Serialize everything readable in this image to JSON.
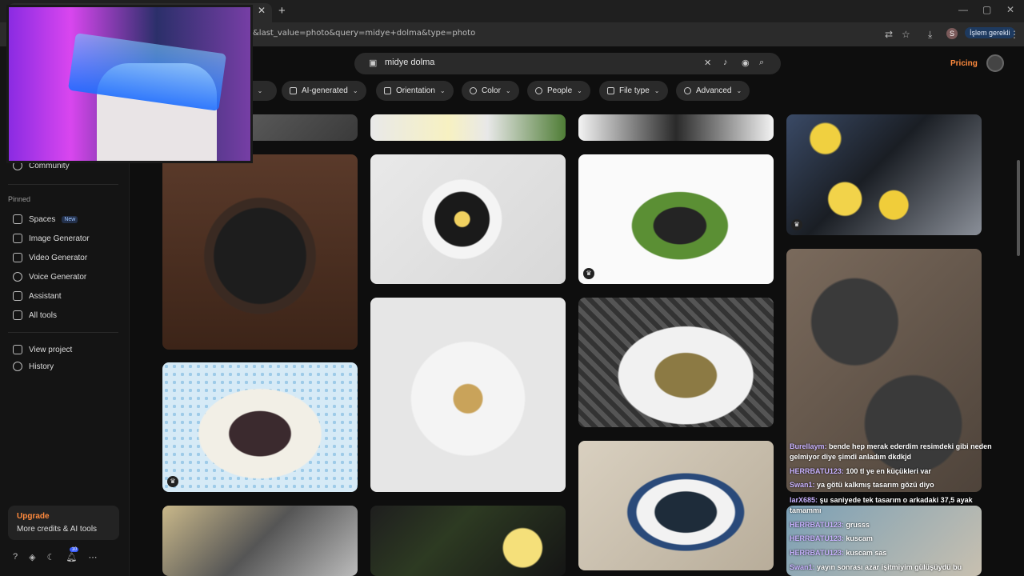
{
  "browser": {
    "url": "&last_value=photo&query=midye+dolma&type=photo",
    "new_tab": "+",
    "close_tab": "✕",
    "profile_letter": "S",
    "pending_label": "İşlem gerekli"
  },
  "sidebar": {
    "community": "Community",
    "pinned_heading": "Pinned",
    "items": [
      {
        "label": "Spaces",
        "badge": "New"
      },
      {
        "label": "Image Generator"
      },
      {
        "label": "Video Generator"
      },
      {
        "label": "Voice Generator"
      },
      {
        "label": "Assistant"
      },
      {
        "label": "All tools"
      }
    ],
    "view_project": "View project",
    "history": "History",
    "upgrade_title": "Upgrade",
    "upgrade_sub": "More credits & AI tools",
    "notif_count": "10"
  },
  "search": {
    "value": "midye dolma"
  },
  "header": {
    "pricing": "Pricing"
  },
  "filters": [
    {
      "label": "e"
    },
    {
      "label": "AI-generated"
    },
    {
      "label": "Orientation"
    },
    {
      "label": "Color"
    },
    {
      "label": "People"
    },
    {
      "label": "File type"
    },
    {
      "label": "Advanced"
    }
  ],
  "chat": [
    {
      "user": "Burellaym:",
      "text": "bende hep merak ederdim resimdeki gibi neden"
    },
    {
      "user": "",
      "text": "gelmiyor diye şimdi anladım dkdkjd"
    },
    {
      "user": "HERRBATU123:",
      "text": "100 tl ye en küçükleri var"
    },
    {
      "user": "Swan1:",
      "text": "ya götü kalkmış tasarım gözü diyo"
    },
    {
      "user": "larX685:",
      "text": "şu saniyede tek tasarım o arkadaki 37,5 ayak"
    },
    {
      "user": "",
      "text": "tamammı"
    },
    {
      "user": "HERRBATU123:",
      "text": "grusss"
    },
    {
      "user": "HERRBATU123:",
      "text": "kuscam"
    },
    {
      "user": "HERRBATU123:",
      "text": "kuscam sas"
    },
    {
      "user": "Swan1:",
      "text": "yayın sonrası azar işitmiyim gülüşüydü bu"
    }
  ]
}
